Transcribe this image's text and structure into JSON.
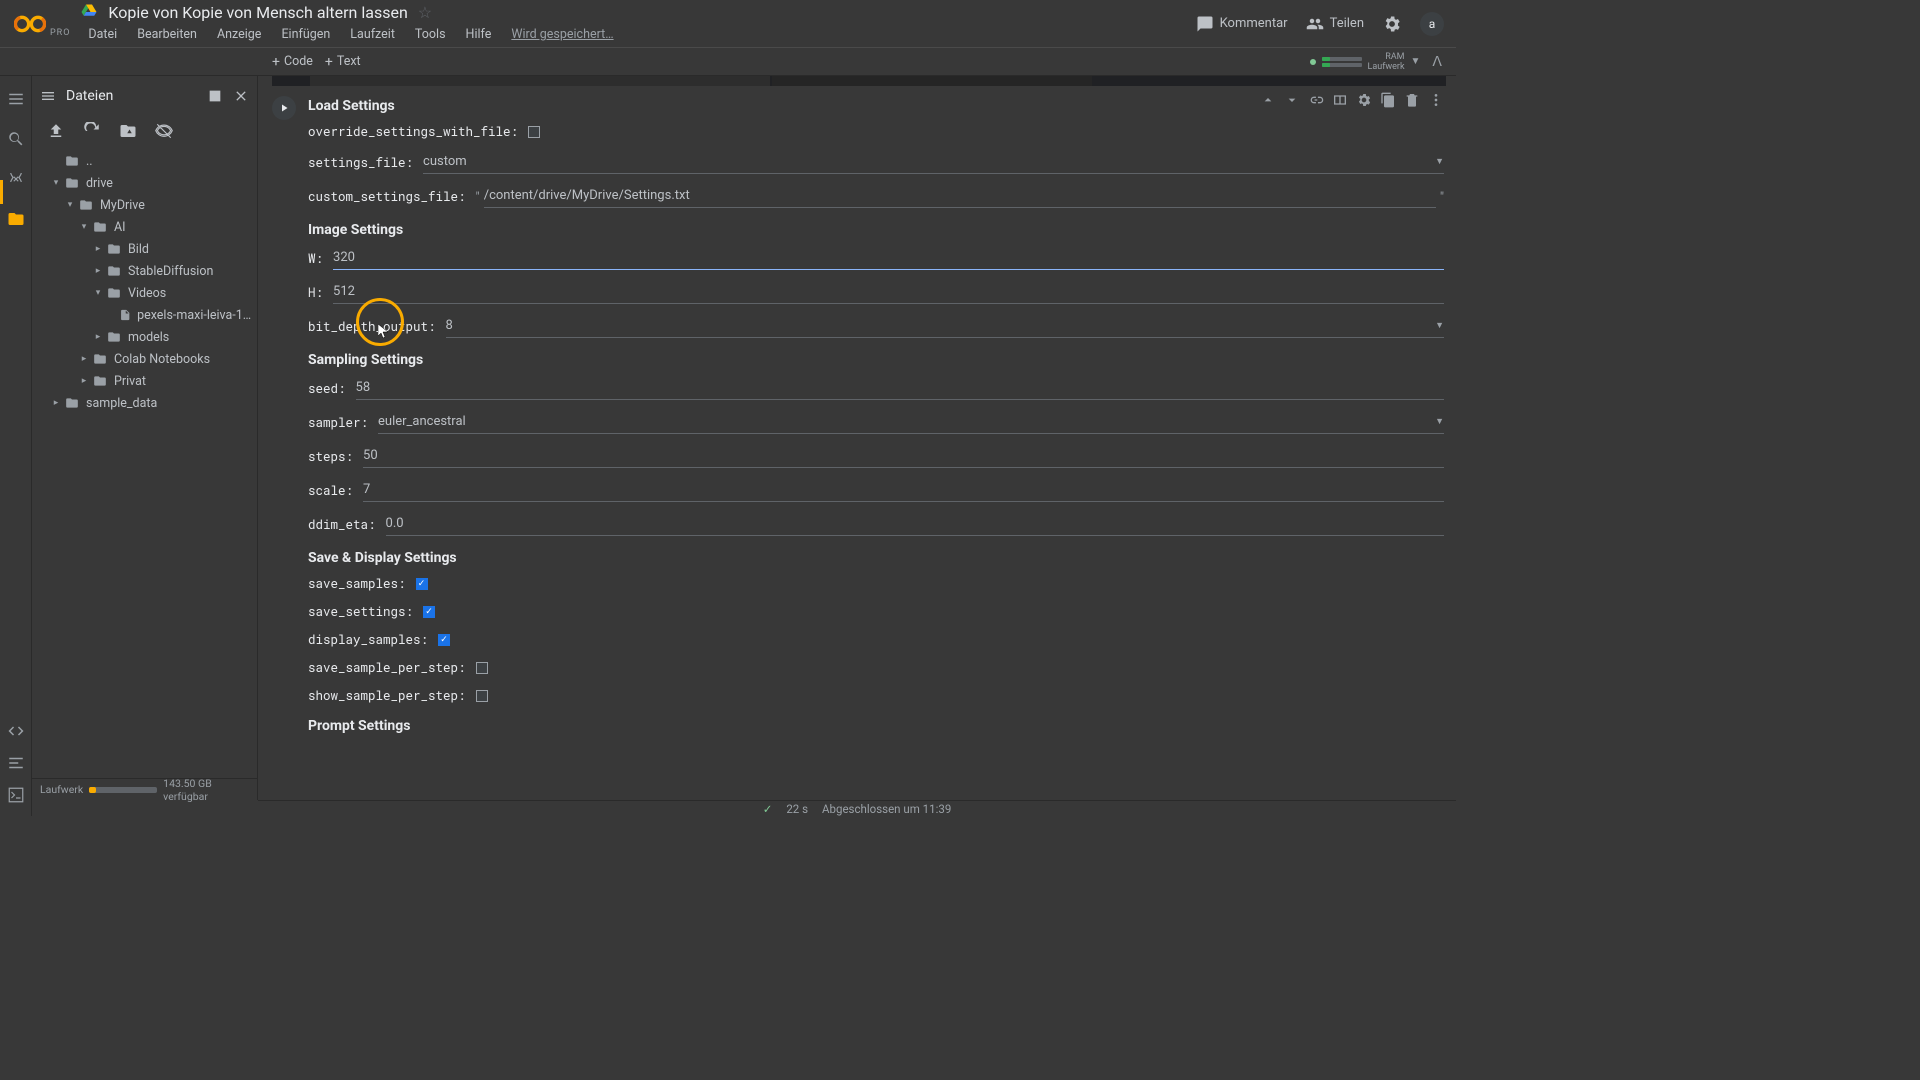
{
  "header": {
    "pro": "PRO",
    "title": "Kopie von Kopie von Mensch altern lassen",
    "menu": [
      "Datei",
      "Bearbeiten",
      "Anzeige",
      "Einfügen",
      "Laufzeit",
      "Tools",
      "Hilfe"
    ],
    "saving": "Wird gespeichert…",
    "comment": "Kommentar",
    "share": "Teilen",
    "avatar": "a"
  },
  "toolbar": {
    "code": "Code",
    "text": "Text",
    "ram_label": "RAM",
    "disk_label": "Laufwerk"
  },
  "sidebar": {
    "title": "Dateien",
    "tree": {
      "dots": "..",
      "drive": "drive",
      "mydrive": "MyDrive",
      "ai": "AI",
      "bild": "Bild",
      "sd": "StableDiffusion",
      "videos": "Videos",
      "pexels": "pexels-maxi-leiva-1314…",
      "models": "models",
      "colabnb": "Colab Notebooks",
      "privat": "Privat",
      "sample": "sample_data"
    },
    "footer_label": "Laufwerk",
    "footer_text": "143.50 GB verfügbar"
  },
  "form": {
    "load_h": "Load Settings",
    "override_label": "override_settings_with_file:",
    "settings_file_label": "settings_file:",
    "settings_file_value": "custom",
    "custom_file_label": "custom_settings_file:",
    "custom_file_value": "/content/drive/MyDrive/Settings.txt",
    "image_h": "Image Settings",
    "w_label": "W:",
    "w_value": "320",
    "h_label": "H:",
    "h_value": "512",
    "bitdepth_label": "bit_depth_output:",
    "bitdepth_value": "8",
    "sampling_h": "Sampling Settings",
    "seed_label": "seed:",
    "seed_value": "58",
    "sampler_label": "sampler:",
    "sampler_value": "euler_ancestral",
    "steps_label": "steps:",
    "steps_value": "50",
    "scale_label": "scale:",
    "scale_value": "7",
    "ddim_label": "ddim_eta:",
    "ddim_value": "0.0",
    "save_h": "Save & Display Settings",
    "save_samples_label": "save_samples:",
    "save_settings_label": "save_settings:",
    "display_samples_label": "display_samples:",
    "save_per_step_label": "save_sample_per_step:",
    "show_per_step_label": "show_sample_per_step:",
    "prompt_h": "Prompt Settings"
  },
  "status": {
    "time": "22 s",
    "text": "Abgeschlossen um 11:39"
  }
}
